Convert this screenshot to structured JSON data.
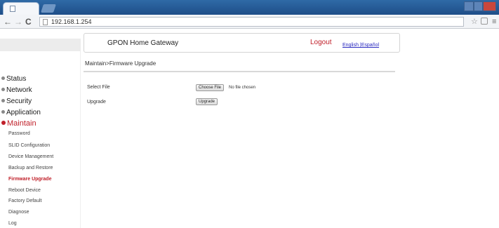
{
  "browser": {
    "url": "192.168.1.254",
    "back_icon": "←",
    "forward_icon": "→",
    "reload_icon": "C"
  },
  "header": {
    "brand": "GPON Home Gateway",
    "logout": "Logout",
    "language": "English |Español"
  },
  "breadcrumb": "Maintain>Firmware Upgrade",
  "sidebar": {
    "sections": [
      {
        "label": "Status"
      },
      {
        "label": "Network"
      },
      {
        "label": "Security"
      },
      {
        "label": "Application"
      },
      {
        "label": "Maintain"
      }
    ],
    "sub_items": [
      {
        "label": "Password"
      },
      {
        "label": "SLID Configuration"
      },
      {
        "label": "Device Management"
      },
      {
        "label": "Backup and Restore"
      },
      {
        "label": "Firmware Upgrade"
      },
      {
        "label": "Reboot Device"
      },
      {
        "label": "Factory Default"
      },
      {
        "label": "Diagnose"
      },
      {
        "label": "Log"
      }
    ]
  },
  "form": {
    "select_file_label": "Select File",
    "choose_file_button": "Choose File",
    "no_file_text": "No file chosen",
    "upgrade_label": "Upgrade",
    "upgrade_button": "Upgrade"
  },
  "colors": {
    "accent": "#c0202a",
    "link": "#2a2ac0"
  }
}
